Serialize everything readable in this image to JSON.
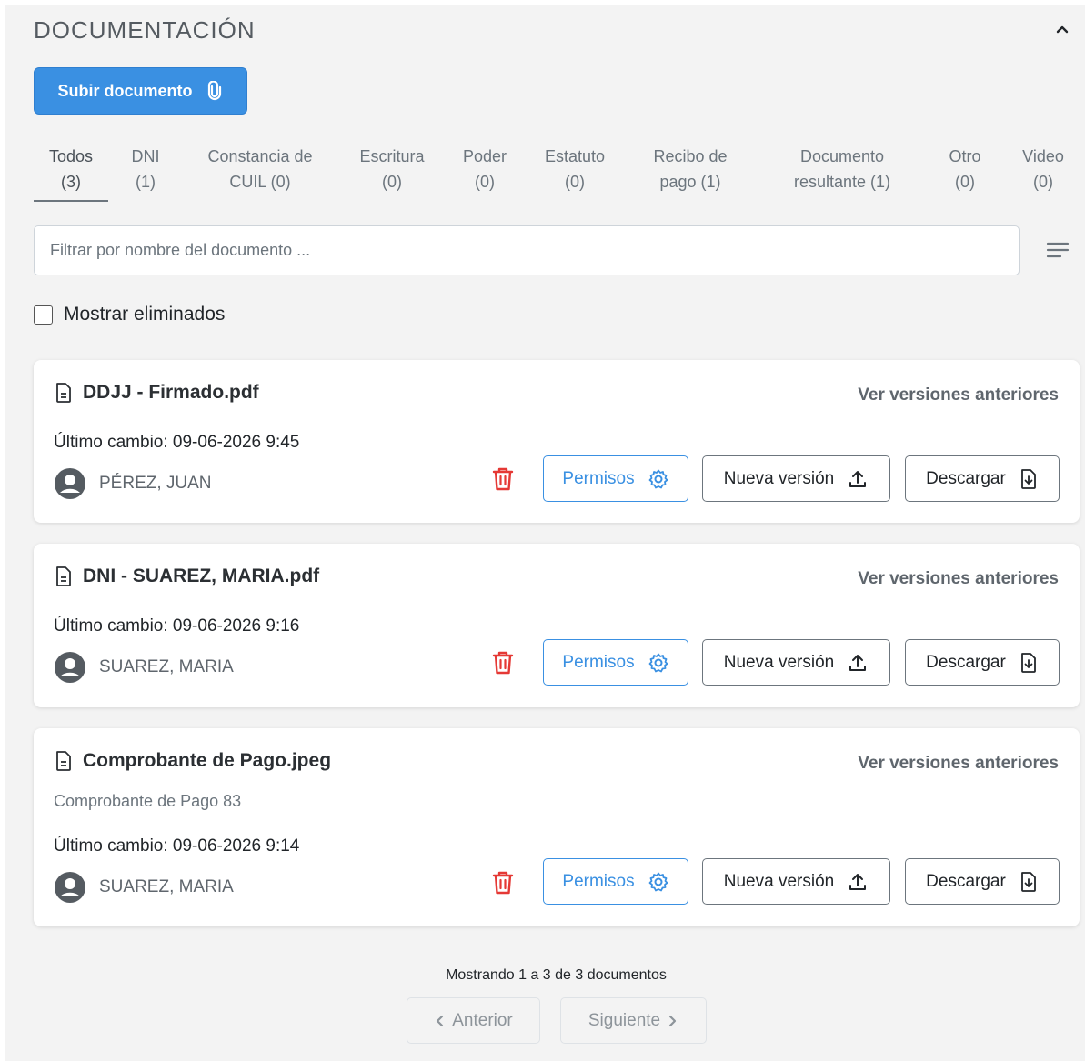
{
  "section": {
    "title": "DOCUMENTACIÓN"
  },
  "upload": {
    "label": "Subir documento"
  },
  "tabs": [
    {
      "line1": "Todos",
      "line2": "(3)"
    },
    {
      "line1": "DNI",
      "line2": "(1)"
    },
    {
      "line1": "Constancia de",
      "line2": "CUIL (0)"
    },
    {
      "line1": "Escritura",
      "line2": "(0)"
    },
    {
      "line1": "Poder",
      "line2": "(0)"
    },
    {
      "line1": "Estatuto",
      "line2": "(0)"
    },
    {
      "line1": "Recibo de",
      "line2": "pago (1)"
    },
    {
      "line1": "Documento",
      "line2": "resultante (1)"
    },
    {
      "line1": "Otro",
      "line2": "(0)"
    },
    {
      "line1": "Video",
      "line2": "(0)"
    }
  ],
  "filter": {
    "placeholder": "Filtrar por nombre del documento ..."
  },
  "show_deleted": {
    "label": "Mostrar eliminados",
    "checked": false
  },
  "documents": [
    {
      "name": "DDJJ - Firmado.pdf",
      "description": "",
      "last_change": "Último cambio: 09-06-2026 9:45",
      "user": "PÉREZ, JUAN"
    },
    {
      "name": "DNI - SUAREZ, MARIA.pdf",
      "description": "",
      "last_change": "Último cambio: 09-06-2026 9:16",
      "user": "SUAREZ, MARIA"
    },
    {
      "name": "Comprobante de Pago.jpeg",
      "description": "Comprobante de Pago 83",
      "last_change": "Último cambio: 09-06-2026 9:14",
      "user": "SUAREZ, MARIA"
    }
  ],
  "card_actions": {
    "versions": "Ver versiones anteriores",
    "permissions": "Permisos",
    "new_version": "Nueva versión",
    "download": "Descargar"
  },
  "pagination": {
    "info": "Mostrando 1 a 3 de 3 documentos",
    "previous": "Anterior",
    "next": "Siguiente"
  },
  "colors": {
    "primary": "#3a90e2",
    "danger": "#e53935",
    "panel_bg": "#f3f3f3"
  }
}
